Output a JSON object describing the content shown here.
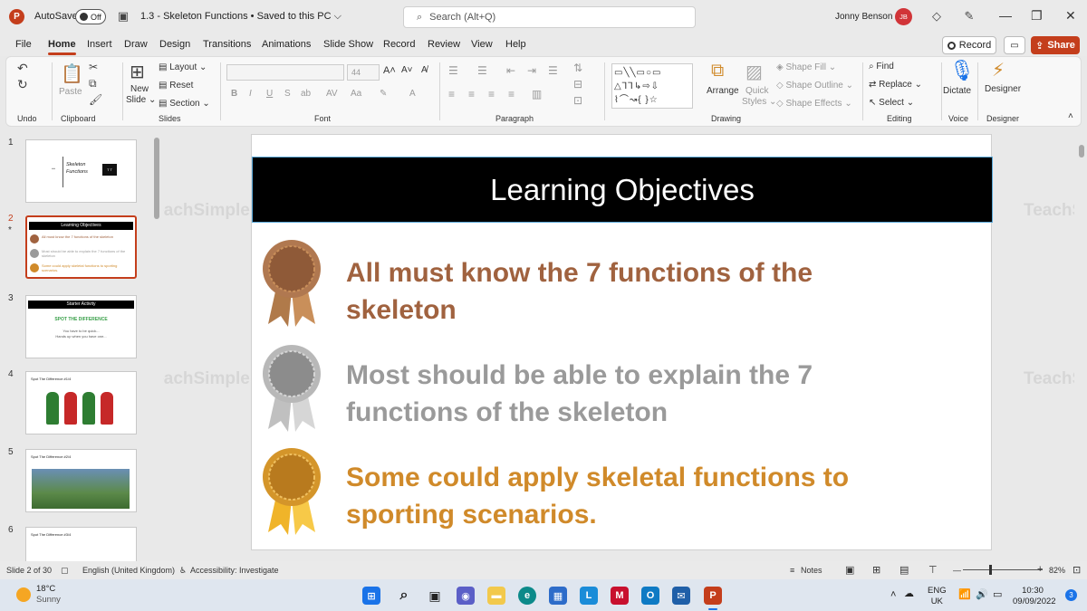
{
  "titlebar": {
    "autosave_label": "AutoSave",
    "autosave_state": "Off",
    "doc_title": "1.3 - Skeleton Functions • Saved to this PC ⌵",
    "search_placeholder": "Search (Alt+Q)",
    "user_name": "Jonny Benson",
    "user_initials": "JB"
  },
  "menu": {
    "items": [
      "File",
      "Home",
      "Insert",
      "Draw",
      "Design",
      "Transitions",
      "Animations",
      "Slide Show",
      "Record",
      "Review",
      "View",
      "Help"
    ],
    "active": "Home",
    "record_label": "Record",
    "share_label": "Share"
  },
  "ribbon": {
    "groups": [
      "Undo",
      "Clipboard",
      "Slides",
      "Font",
      "Paragraph",
      "Drawing",
      "Editing",
      "Voice",
      "Designer"
    ],
    "paste": "Paste",
    "new_slide": "New",
    "new_slide2": "Slide ⌄",
    "layout": "Layout ⌄",
    "reset": "Reset",
    "section": "Section ⌄",
    "font_size": "44",
    "arrange": "Arrange",
    "quick_styles": "Quick",
    "quick_styles2": "Styles ⌄",
    "shape_fill": "Shape Fill ⌄",
    "shape_outline": "Shape Outline ⌄",
    "shape_effects": "Shape Effects ⌄",
    "find": "Find",
    "replace": "Replace ⌄",
    "select": "Select ⌄",
    "dictate": "Dictate",
    "designer": "Designer"
  },
  "thumbnails": [
    {
      "num": "1",
      "text1": "Skeleton",
      "text2": "Functions",
      "badge": "T T"
    },
    {
      "num": "2",
      "title": "Learning Objectives",
      "lines": [
        "All must know the 7 functions of the skeleton",
        "Most should be able to explain the 7 functions of the skeleton",
        "Some could apply skeletal functions to sporting scenarios."
      ]
    },
    {
      "num": "3",
      "title": "Starter Activity",
      "sub": "SPOT THE DIFFERENCE",
      "line1": "You have to be quick...",
      "line2": "Hands up when you have one..."
    },
    {
      "num": "4",
      "title": "Spot The Difference #1/4"
    },
    {
      "num": "5",
      "title": "Spot The Difference #2/4"
    },
    {
      "num": "6",
      "title": "Spot The Difference #3/4"
    }
  ],
  "slide": {
    "title": "Learning Objectives",
    "objectives": [
      {
        "line1": "All must know the 7 functions of the",
        "line2": "skeleton",
        "color": "#a0623f"
      },
      {
        "line1": "Most should be able to explain the 7",
        "line2": "functions of the skeleton",
        "color": "#9a9a9a"
      },
      {
        "line1": "Some could apply skeletal functions to",
        "line2": "sporting scenarios.",
        "color": "#d08a2a"
      }
    ],
    "watermark": "TeachSimple"
  },
  "statusbar": {
    "slide_count": "Slide 2 of 30",
    "language": "English (United Kingdom)",
    "accessibility": "Accessibility: Investigate",
    "notes": "Notes",
    "zoom": "82%"
  },
  "taskbar": {
    "temp": "18°C",
    "weather": "Sunny",
    "lang1": "ENG",
    "lang2": "UK",
    "time": "10:30",
    "date": "09/09/2022",
    "notifications": "3"
  }
}
